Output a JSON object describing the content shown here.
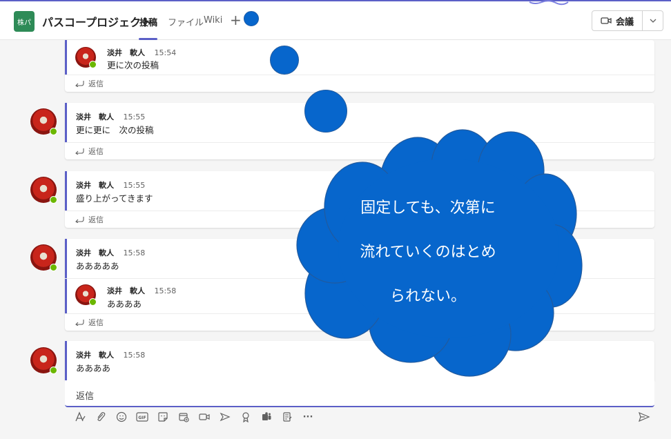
{
  "header": {
    "team_initials": "株パ",
    "team_name": "パスコープロジェクト",
    "tabs": [
      {
        "label": "投稿",
        "active": true
      },
      {
        "label": "ファイル",
        "active": false
      },
      {
        "label": "Wiki",
        "active": false
      }
    ],
    "add_tab_icon": "plus-icon",
    "meet_label": "会議",
    "meet_icon": "video-camera-icon",
    "meet_dropdown_icon": "chevron-down-icon"
  },
  "messages": [
    {
      "type": "reply",
      "author": "淡井　軟人",
      "time": "15:54",
      "text": "更に次の投稿",
      "reply_label": "返信"
    },
    {
      "type": "post",
      "author": "淡井　軟人",
      "time": "15:55",
      "text": "更に更に　次の投稿",
      "reply_label": "返信"
    },
    {
      "type": "post",
      "author": "淡井　軟人",
      "time": "15:55",
      "text": "盛り上がってきます",
      "reply_label": "返信"
    },
    {
      "type": "post",
      "author": "淡井　軟人",
      "time": "15:58",
      "text": "あああああ",
      "reply": {
        "author": "淡井　軟人",
        "time": "15:58",
        "text": "ああああ"
      },
      "reply_label": "返信"
    },
    {
      "type": "post",
      "author": "淡井　軟人",
      "time": "15:58",
      "text": "ああああ"
    }
  ],
  "compose": {
    "text": "返信",
    "toolbar_icons": [
      "format-icon",
      "attach-icon",
      "emoji-icon",
      "gif-icon",
      "sticker-icon",
      "schedule-meeting-icon",
      "video-icon",
      "stream-icon",
      "praise-icon",
      "teams-app-icon",
      "forms-icon",
      "more-icon"
    ],
    "send_icon": "send-icon"
  },
  "callout": {
    "lines": [
      "固定しても、次第に",
      "流れていくのはとめ",
      "られない。"
    ]
  },
  "colors": {
    "accent": "#5b5fc7",
    "callout": "#0766cc",
    "presence": "#6bb700",
    "team_avatar": "#2e8b57"
  }
}
